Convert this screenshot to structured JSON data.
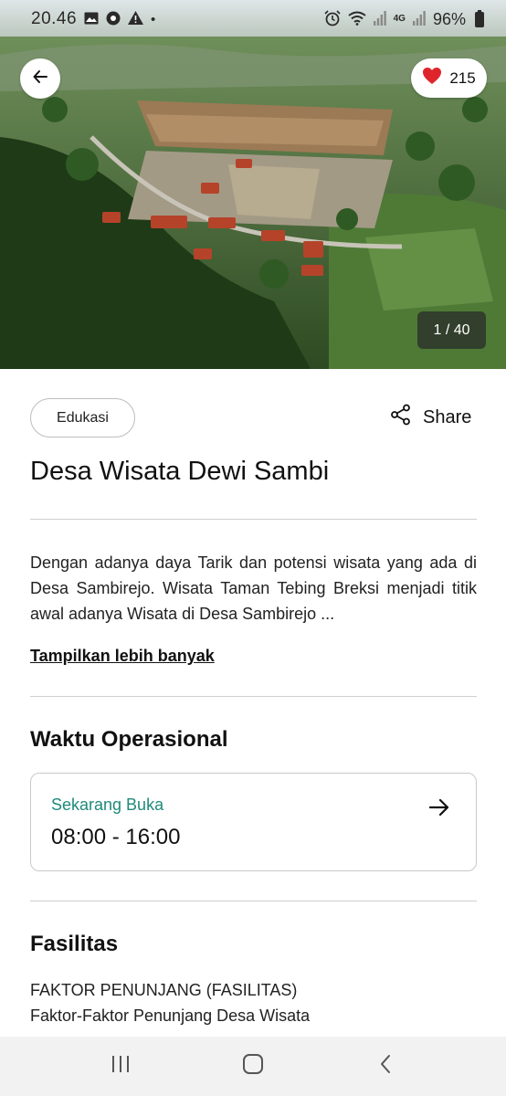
{
  "status_bar": {
    "time": "20.46",
    "battery": "96%",
    "network": "4G"
  },
  "hero": {
    "likes": "215",
    "image_counter": "1 / 40"
  },
  "category_chip": "Edukasi",
  "share_label": "Share",
  "title": "Desa Wisata Dewi Sambi",
  "description": "Dengan adanya daya Tarik dan potensi wisata yang ada di Desa Sambirejo. Wisata Taman Tebing Breksi menjadi titik awal adanya Wisata di Desa Sambirejo ...",
  "show_more": "Tampilkan lebih banyak",
  "operational": {
    "heading": "Waktu Operasional",
    "status": "Sekarang Buka",
    "hours": "08:00 - 16:00"
  },
  "facilities": {
    "heading": "Fasilitas",
    "lines": [
      "FAKTOR PENUNJANG (FASILITAS)",
      "Faktor-Faktor Penunjang Desa Wisata"
    ]
  },
  "colors": {
    "open_status": "#1f8a7a",
    "heart": "#e0242b"
  },
  "icons": [
    "image-icon",
    "chrome-icon",
    "warning-icon",
    "alarm-icon",
    "wifi-icon",
    "signal-icon",
    "battery-icon",
    "back-arrow-icon",
    "heart-icon",
    "share-icon",
    "arrow-right-icon",
    "recent-apps-icon",
    "home-icon",
    "nav-back-icon"
  ]
}
